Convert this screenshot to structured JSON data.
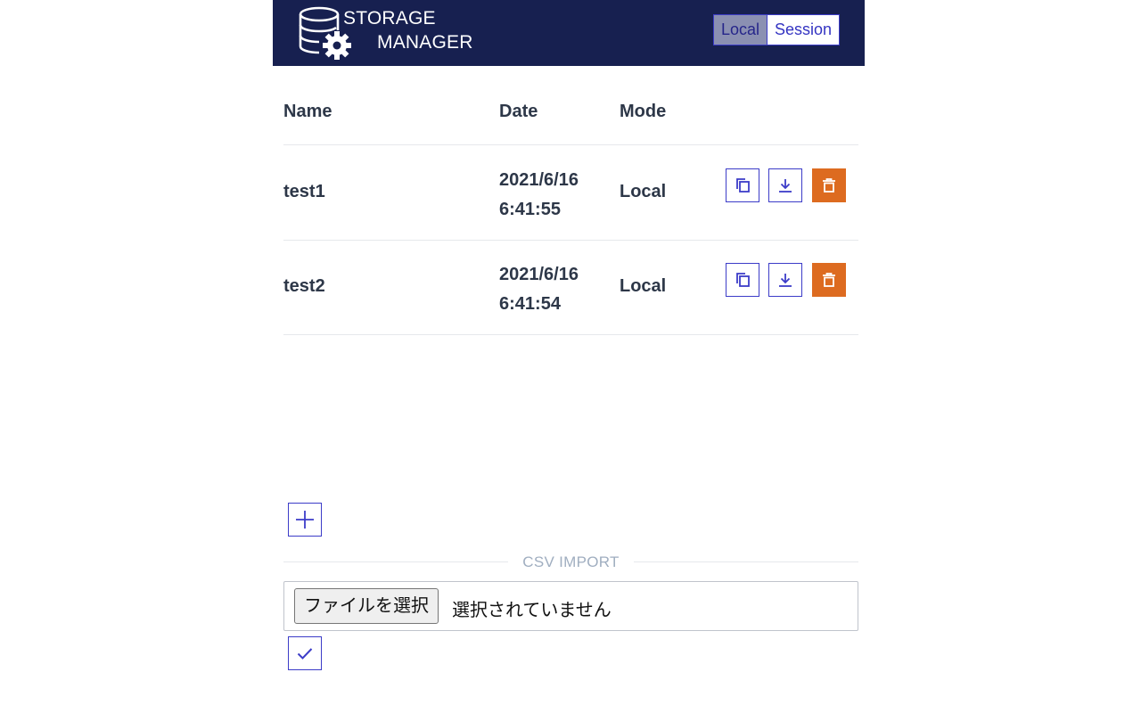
{
  "header": {
    "logo_line1": "STORAGE",
    "logo_line2": "MANAGER",
    "mode_options": [
      "Local",
      "Session"
    ],
    "selected_mode": "Local"
  },
  "table": {
    "columns": [
      "Name",
      "Date",
      "Mode"
    ],
    "rows": [
      {
        "name": "test1",
        "date_line1": "2021/6/16",
        "date_line2": "6:41:55",
        "mode": "Local"
      },
      {
        "name": "test2",
        "date_line1": "2021/6/16",
        "date_line2": "6:41:54",
        "mode": "Local"
      }
    ],
    "row_actions": [
      "copy-icon",
      "download-icon",
      "trash-icon"
    ]
  },
  "add_button_icon": "plus-icon",
  "csv_import": {
    "label": "CSV IMPORT",
    "choose_file_label": "ファイルを選択",
    "no_file_text": "選択されていません",
    "confirm_icon": "check-icon"
  },
  "colors": {
    "header_bg": "#172050",
    "accent": "#3c3cc8",
    "danger": "#dd6b20",
    "toggle_active_bg": "#8b90b2"
  }
}
